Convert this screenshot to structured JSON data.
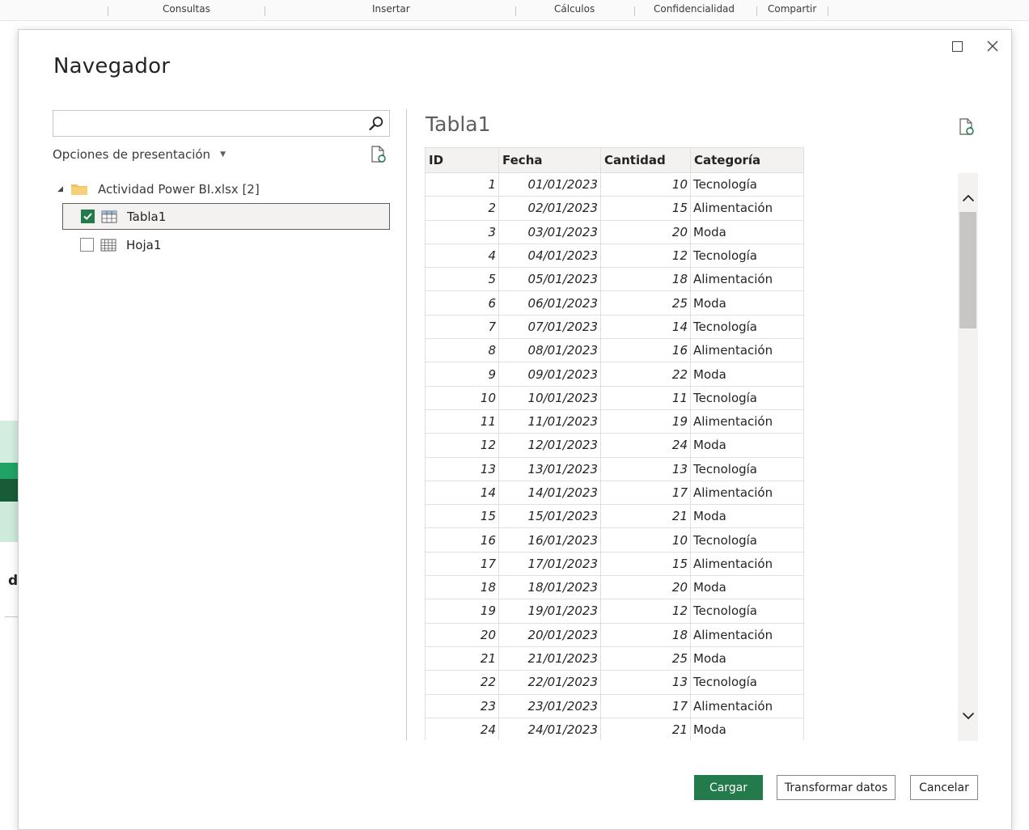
{
  "ribbon": {
    "groups": [
      "Consultas",
      "Insertar",
      "Cálculos",
      "Confidencialidad",
      "Compartir"
    ]
  },
  "background": {
    "letter": "d"
  },
  "dialog": {
    "title": "Navegador",
    "window_controls": {
      "maximize": "maximize-icon",
      "close": "close-icon"
    }
  },
  "navigator": {
    "search_value": "",
    "search_placeholder": "",
    "display_options_label": "Opciones de presentación",
    "tree": {
      "root_label": "Actividad Power BI.xlsx [2]",
      "items": [
        {
          "label": "Tabla1",
          "checked": true,
          "selected": true
        },
        {
          "label": "Hoja1",
          "checked": false,
          "selected": false
        }
      ]
    }
  },
  "preview": {
    "title": "Tabla1",
    "columns": [
      "ID",
      "Fecha",
      "Cantidad",
      "Categoría"
    ],
    "rows": [
      [
        "1",
        "01/01/2023",
        "10",
        "Tecnología"
      ],
      [
        "2",
        "02/01/2023",
        "15",
        "Alimentación"
      ],
      [
        "3",
        "03/01/2023",
        "20",
        "Moda"
      ],
      [
        "4",
        "04/01/2023",
        "12",
        "Tecnología"
      ],
      [
        "5",
        "05/01/2023",
        "18",
        "Alimentación"
      ],
      [
        "6",
        "06/01/2023",
        "25",
        "Moda"
      ],
      [
        "7",
        "07/01/2023",
        "14",
        "Tecnología"
      ],
      [
        "8",
        "08/01/2023",
        "16",
        "Alimentación"
      ],
      [
        "9",
        "09/01/2023",
        "22",
        "Moda"
      ],
      [
        "10",
        "10/01/2023",
        "11",
        "Tecnología"
      ],
      [
        "11",
        "11/01/2023",
        "19",
        "Alimentación"
      ],
      [
        "12",
        "12/01/2023",
        "24",
        "Moda"
      ],
      [
        "13",
        "13/01/2023",
        "13",
        "Tecnología"
      ],
      [
        "14",
        "14/01/2023",
        "17",
        "Alimentación"
      ],
      [
        "15",
        "15/01/2023",
        "21",
        "Moda"
      ],
      [
        "16",
        "16/01/2023",
        "10",
        "Tecnología"
      ],
      [
        "17",
        "17/01/2023",
        "15",
        "Alimentación"
      ],
      [
        "18",
        "18/01/2023",
        "20",
        "Moda"
      ],
      [
        "19",
        "19/01/2023",
        "12",
        "Tecnología"
      ],
      [
        "20",
        "20/01/2023",
        "18",
        "Alimentación"
      ],
      [
        "21",
        "21/01/2023",
        "25",
        "Moda"
      ],
      [
        "22",
        "22/01/2023",
        "13",
        "Tecnología"
      ],
      [
        "23",
        "23/01/2023",
        "17",
        "Alimentación"
      ],
      [
        "24",
        "24/01/2023",
        "21",
        "Moda"
      ]
    ]
  },
  "buttons": {
    "load": "Cargar",
    "transform": "Transformar datos",
    "cancel": "Cancelar"
  },
  "colors": {
    "accent": "#237b4b",
    "border": "#c8c6c4",
    "header_bg": "#f3f2f1",
    "folder": "#f0c05a"
  },
  "icons": {
    "search": "search-icon",
    "refresh": "refresh-icon",
    "folder": "folder-icon",
    "table": "table-icon",
    "sheet": "sheet-icon",
    "scroll_up": "chevron-up-icon",
    "scroll_down": "chevron-down-icon"
  }
}
